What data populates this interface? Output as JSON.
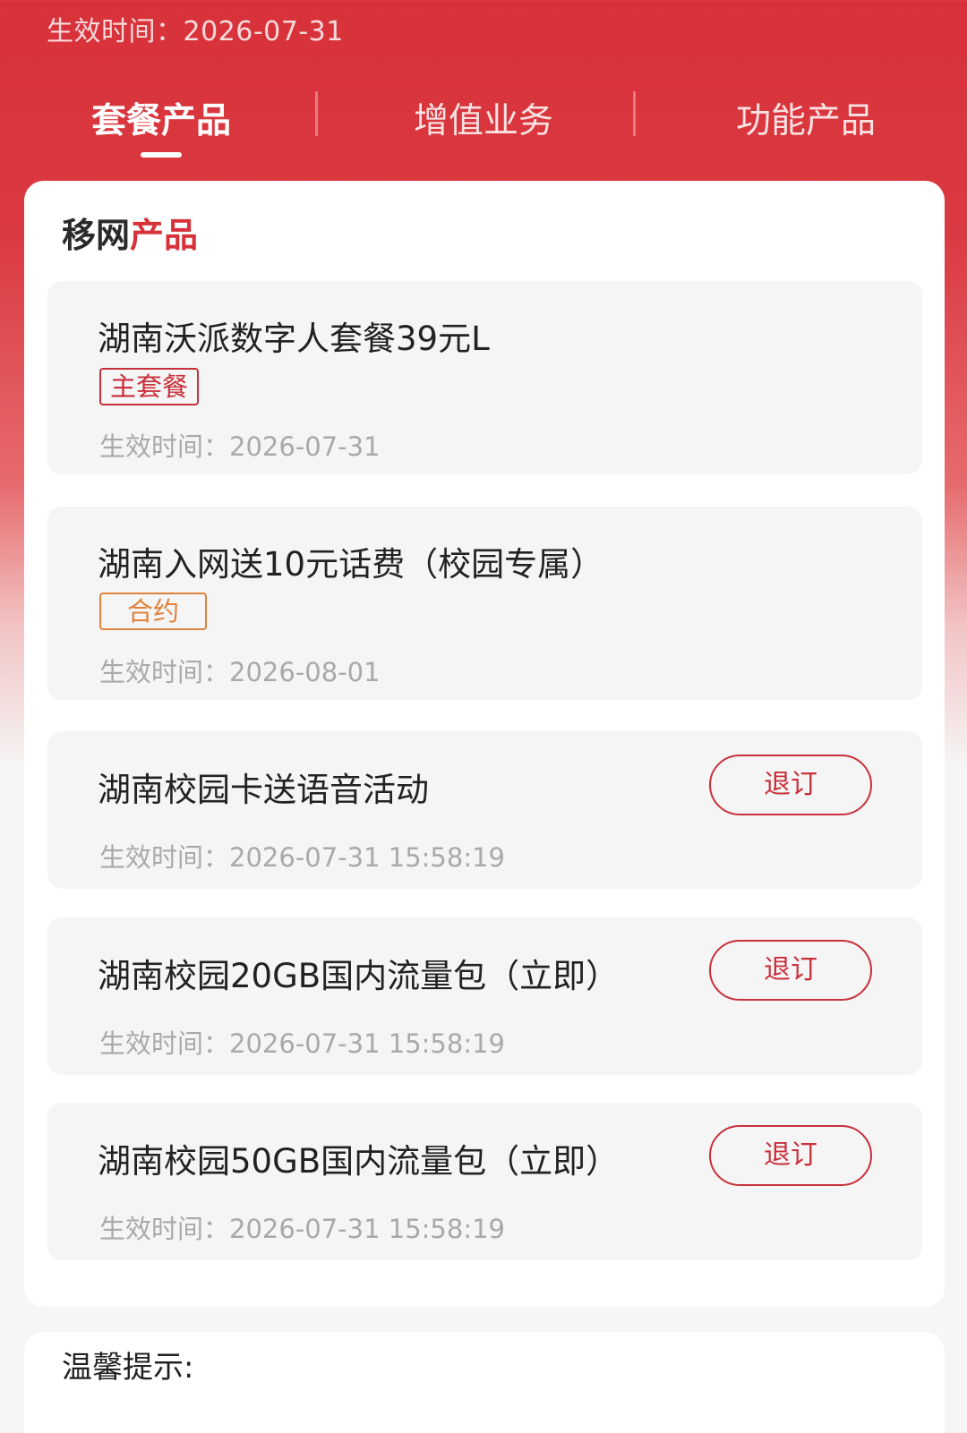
{
  "header": {
    "effective_date": "生效时间：2026-07-31"
  },
  "tabs": [
    {
      "label": "套餐产品",
      "active": true
    },
    {
      "label": "增值业务",
      "active": false
    },
    {
      "label": "功能产品",
      "active": false
    }
  ],
  "section": {
    "title_part1": "移网",
    "title_part2": "产品"
  },
  "products": [
    {
      "name": "湖南沃派数字人套餐39元L",
      "tag": "主套餐",
      "time": "生效时间：2026-07-31"
    },
    {
      "name": "湖南入网送10元话费（校园专属）",
      "tag": "合约",
      "time": "生效时间：2026-08-01"
    },
    {
      "name": "湖南校园卡送语音活动",
      "time": "生效时间：2026-07-31 15:58:19",
      "button": "退订"
    },
    {
      "name": "湖南校园20GB国内流量包（立即）",
      "time": "生效时间：2026-07-31 15:58:19",
      "button": "退订"
    },
    {
      "name": "湖南校园50GB国内流量包（立即）",
      "time": "生效时间：2026-07-31 15:58:19",
      "button": "退订"
    }
  ],
  "tips": {
    "title": "温馨提示:"
  },
  "colors": {
    "brand_red": "#d8313a",
    "tag_red": "#c9303b",
    "tag_orange": "#e0823a"
  }
}
